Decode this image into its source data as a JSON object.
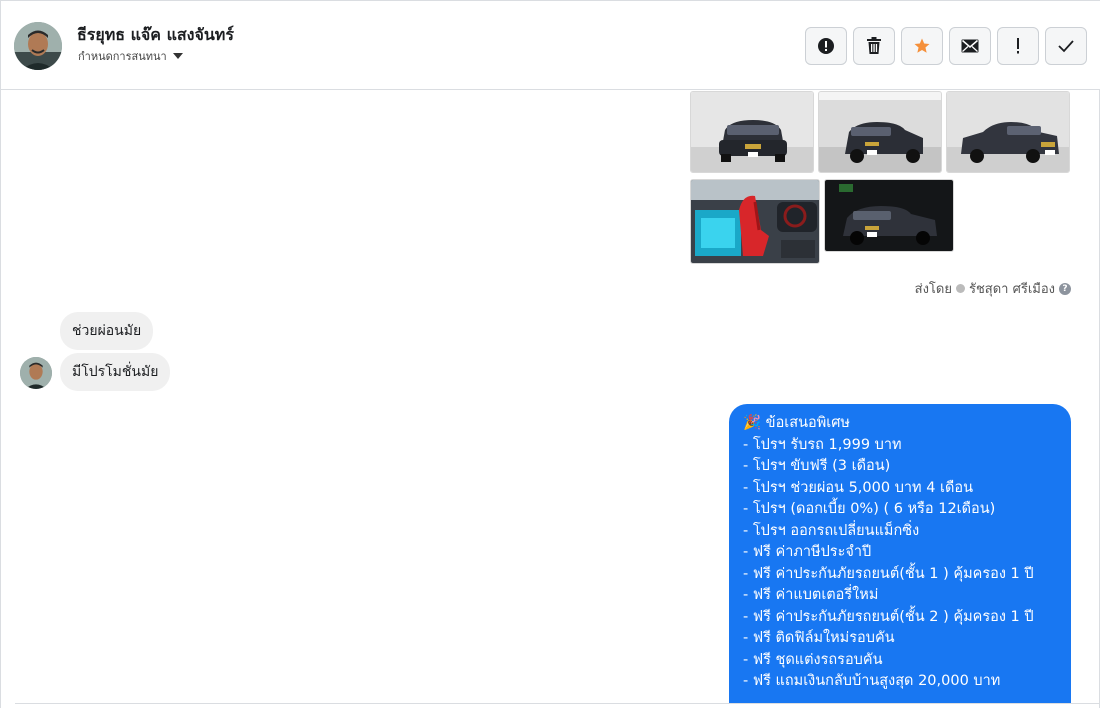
{
  "header": {
    "contact_name": "ธีรยุทธ แจ๊ค แสงจันทร์",
    "conversation_setting": "กำหนดการสนทนา",
    "actions": [
      {
        "icon": "alert-circle-icon"
      },
      {
        "icon": "trash-icon"
      },
      {
        "icon": "star-icon",
        "color": "#f5903b"
      },
      {
        "icon": "envelope-icon"
      },
      {
        "icon": "exclamation-icon"
      },
      {
        "icon": "checkmark-icon"
      }
    ]
  },
  "thread": {
    "sent_by_label": "ส่งโดย",
    "sent_by_name": "รัชสุดา ศรีเมือง",
    "incoming": [
      "ช่วยผ่อนมัย",
      "มีโปรโมชั่นมัย"
    ],
    "outgoing_lines": [
      "🎉 ข้อเสนอพิเศษ",
      "- โปรฯ รับรถ 1,999 บาท",
      "- โปรฯ ขับฟรี (3 เดือน)",
      "- โปรฯ ช่วยผ่อน 5,000 บาท 4 เดือน",
      "- โปรฯ (ดอกเบี้ย 0%) ( 6 หรือ 12เดือน)",
      "- โปรฯ ออกรถเปลี่ยนแม็กซิ่ง",
      "- ฟรี ค่าภาษีประจำปี",
      "- ฟรี ค่าประกันภัยรถยนต์(ชั้น 1 ) คุ้มครอง 1 ปี",
      "- ฟรี ค่าแบตเตอรี่ใหม่",
      "- ฟรี ค่าประกันภัยรถยนต์(ชั้น 2 ) คุ้มครอง 1 ปี",
      "- ฟรี ติดฟิล์มใหม่รอบคัน",
      "- ฟรี ชุดแต่งรถรอบคัน",
      "- ฟรี แถมเงินกลับบ้านสูงสุด 20,000 บาท"
    ],
    "colors": {
      "outgoing_bubble": "#1877f2",
      "incoming_bubble": "#f0f0f0"
    }
  }
}
